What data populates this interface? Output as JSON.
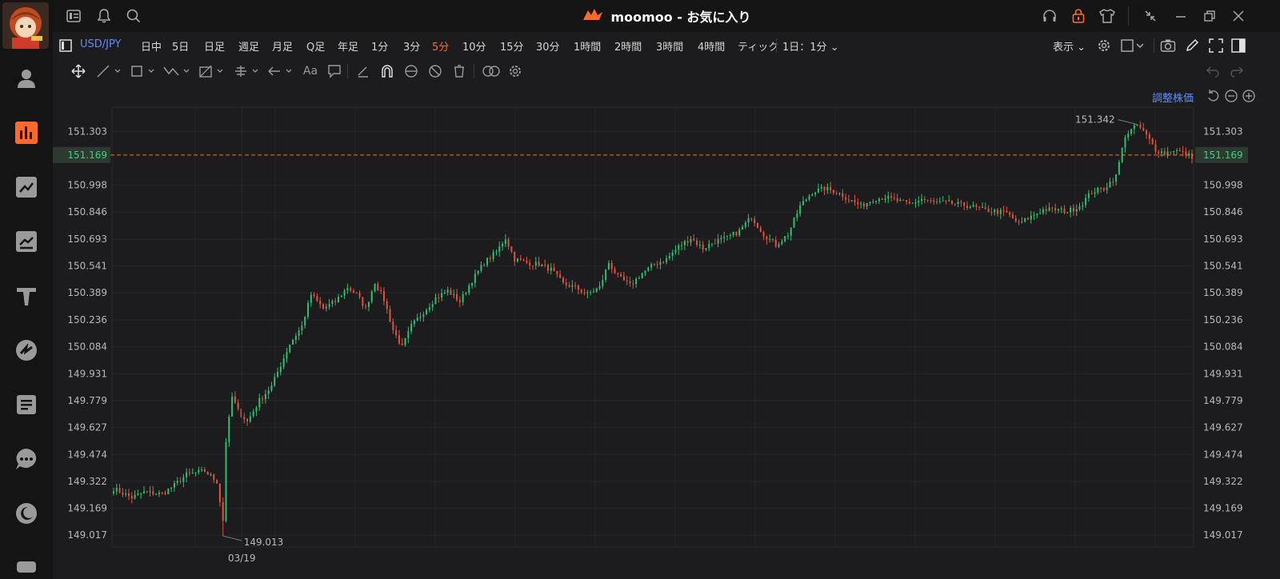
{
  "window": {
    "title": "moomoo - お気に入り"
  },
  "toolbar": {
    "symbol": "USD/JPY",
    "timeframes": [
      "日中",
      "5日",
      "日足",
      "週足",
      "月足",
      "Q足",
      "年足",
      "1分",
      "3分",
      "5分",
      "10分",
      "15分",
      "30分",
      "1時間",
      "2時間",
      "3時間",
      "4時間",
      "ティック"
    ],
    "active_timeframe": "5分",
    "interval_select": "1日：1分",
    "display_label": "表示"
  },
  "chart": {
    "adjust_label": "調整株価"
  },
  "chart_data": {
    "type": "candlestick",
    "y_ticks": [
      "151.303",
      "150.998",
      "150.846",
      "150.693",
      "150.541",
      "150.389",
      "150.236",
      "150.084",
      "149.931",
      "149.779",
      "149.627",
      "149.474",
      "149.322",
      "149.169",
      "149.017"
    ],
    "x_labels": [
      "03/19"
    ],
    "current_price": "151.169",
    "high_label": "151.342",
    "low_label": "149.013",
    "ylim": [
      148.95,
      151.44
    ],
    "colors": {
      "up": "#2fbf71",
      "down": "#e0533d",
      "price_line": "#e87a2e"
    },
    "close_path": [
      [
        0,
        149.28
      ],
      [
        6,
        149.23
      ],
      [
        10,
        149.26
      ],
      [
        16,
        149.25
      ],
      [
        20,
        149.3
      ],
      [
        24,
        149.36
      ],
      [
        30,
        149.38
      ],
      [
        34,
        149.32
      ],
      [
        36,
        149.1
      ],
      [
        37,
        149.55
      ],
      [
        39,
        149.8
      ],
      [
        41,
        149.72
      ],
      [
        44,
        149.66
      ],
      [
        48,
        149.78
      ],
      [
        52,
        149.86
      ],
      [
        55,
        149.98
      ],
      [
        58,
        150.1
      ],
      [
        62,
        150.2
      ],
      [
        65,
        150.38
      ],
      [
        69,
        150.3
      ],
      [
        73,
        150.34
      ],
      [
        77,
        150.42
      ],
      [
        80,
        150.38
      ],
      [
        83,
        150.3
      ],
      [
        86,
        150.45
      ],
      [
        89,
        150.35
      ],
      [
        92,
        150.18
      ],
      [
        95,
        150.08
      ],
      [
        98,
        150.2
      ],
      [
        102,
        150.28
      ],
      [
        106,
        150.36
      ],
      [
        110,
        150.4
      ],
      [
        114,
        150.34
      ],
      [
        118,
        150.46
      ],
      [
        122,
        150.56
      ],
      [
        126,
        150.62
      ],
      [
        129,
        150.7
      ],
      [
        132,
        150.58
      ],
      [
        136,
        150.56
      ],
      [
        140,
        150.55
      ],
      [
        144,
        150.52
      ],
      [
        148,
        150.44
      ],
      [
        152,
        150.42
      ],
      [
        156,
        150.38
      ],
      [
        160,
        150.42
      ],
      [
        163,
        150.56
      ],
      [
        166,
        150.48
      ],
      [
        170,
        150.43
      ],
      [
        174,
        150.5
      ],
      [
        178,
        150.55
      ],
      [
        182,
        150.58
      ],
      [
        186,
        150.65
      ],
      [
        190,
        150.7
      ],
      [
        194,
        150.64
      ],
      [
        198,
        150.68
      ],
      [
        202,
        150.7
      ],
      [
        206,
        150.74
      ],
      [
        210,
        150.82
      ],
      [
        214,
        150.72
      ],
      [
        218,
        150.66
      ],
      [
        222,
        150.72
      ],
      [
        226,
        150.88
      ],
      [
        230,
        150.96
      ],
      [
        234,
        150.98
      ],
      [
        238,
        150.96
      ],
      [
        242,
        150.92
      ],
      [
        246,
        150.88
      ],
      [
        250,
        150.92
      ],
      [
        254,
        150.93
      ],
      [
        258,
        150.91
      ],
      [
        262,
        150.89
      ],
      [
        266,
        150.92
      ],
      [
        270,
        150.9
      ],
      [
        274,
        150.9
      ],
      [
        278,
        150.89
      ],
      [
        282,
        150.88
      ],
      [
        286,
        150.86
      ],
      [
        290,
        150.85
      ],
      [
        294,
        150.84
      ],
      [
        298,
        150.78
      ],
      [
        302,
        150.82
      ],
      [
        306,
        150.86
      ],
      [
        310,
        150.86
      ],
      [
        314,
        150.85
      ],
      [
        318,
        150.88
      ],
      [
        322,
        150.96
      ],
      [
        326,
        150.98
      ],
      [
        330,
        151.05
      ],
      [
        333,
        151.28
      ],
      [
        337,
        151.34
      ],
      [
        340,
        151.28
      ],
      [
        343,
        151.2
      ],
      [
        346,
        151.18
      ],
      [
        349,
        151.2
      ],
      [
        352,
        151.18
      ],
      [
        355,
        151.16
      ]
    ]
  }
}
